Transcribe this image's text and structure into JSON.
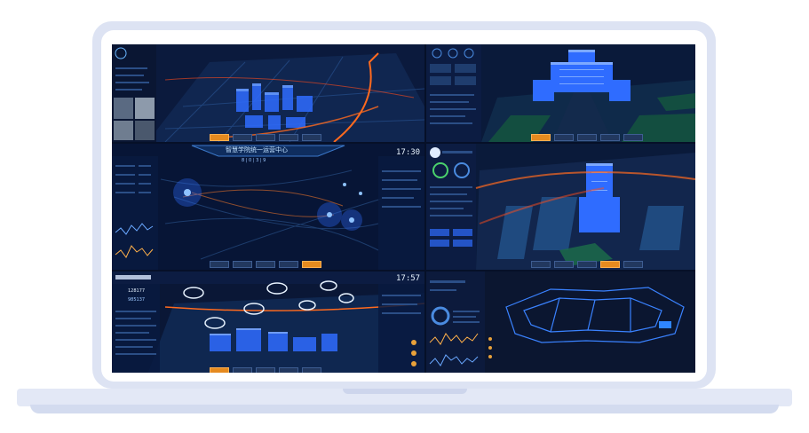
{
  "colors": {
    "laptop_frame": "#dde3f3",
    "screen_bg": "#061028",
    "building_glow": "#2f6cff",
    "route_orange": "#ff6a1e",
    "active_button": "#e58a1f"
  },
  "panels": {
    "center_title": "智慧学院统一运营中心",
    "center_clock": "17:30",
    "center_counter": "8 | 0 | 3 | 9",
    "bottom_left_clock": "17:57",
    "bottom_left_counter": "128177",
    "bottom_left_stat": "985137"
  },
  "icons": {
    "logo": "university-logo-icon",
    "camera": "camera-marker-icon"
  }
}
